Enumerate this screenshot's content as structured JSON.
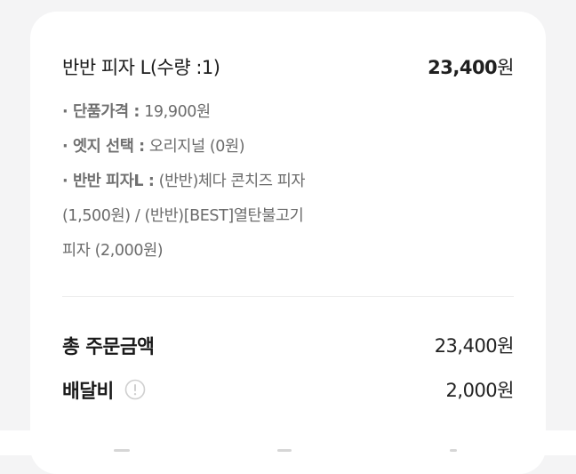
{
  "order_item": {
    "name": "반반 피자 L(수량 :1)",
    "price_number": "23,400",
    "price_unit": "원"
  },
  "options": {
    "unit_price_label": "· 단품가격 :",
    "unit_price_value": "19,900원",
    "edge_label": "· 엣지 선택 :",
    "edge_value": "오리지널 (0원)",
    "half_label": "· 반반 피자L :",
    "half_value_line1": "(반반)체다 콘치즈 피자",
    "half_value_line2": "(1,500원) / (반반)[BEST]열탄불고기",
    "half_value_line3": "피자 (2,000원)"
  },
  "summary": {
    "total_label": "총 주문금액",
    "total_value": "23,400원",
    "delivery_label": "배달비",
    "delivery_value": "2,000원"
  },
  "icons": {
    "delivery_info": "info-icon"
  }
}
